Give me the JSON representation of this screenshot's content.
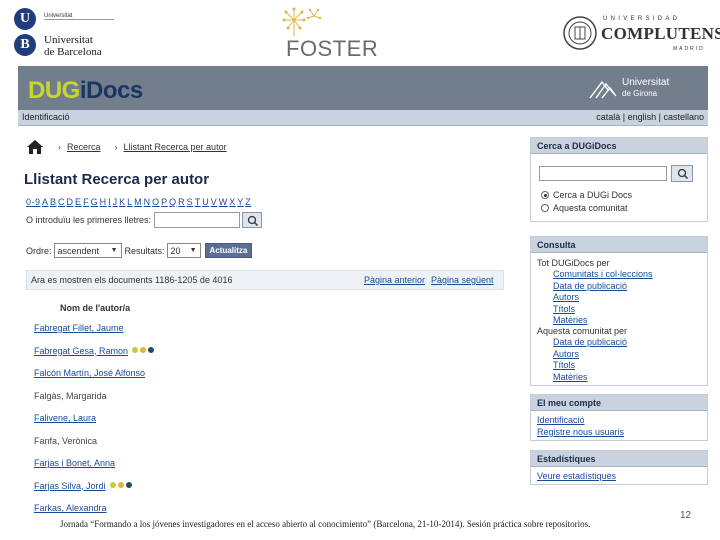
{
  "logos": {
    "ub_sub": "Universitat",
    "ub_name_1": "Universitat",
    "ub_name_2": "de Barcelona",
    "foster": "FOSTER",
    "ucm_top": "UNIVERSIDAD",
    "ucm_main": "COMPLUTENSE",
    "ucm_bottom": "MADRID"
  },
  "header": {
    "brand_a": "DUG",
    "brand_b": "i",
    "brand_c": "Docs",
    "udg_line1": "Universitat",
    "udg_line2": "de Girona",
    "ident": "Identificació",
    "langs": "català | english | castellano"
  },
  "breadcrumb": {
    "item1": "Recerca",
    "item2": "Llistant Recerca per autor"
  },
  "main": {
    "title": "Llistant Recerca per autor",
    "letters": [
      "0-9",
      "A",
      "B",
      "C",
      "D",
      "E",
      "F",
      "G",
      "H",
      "I",
      "J",
      "K",
      "L",
      "M",
      "N",
      "O",
      "P",
      "Q",
      "R",
      "S",
      "T",
      "U",
      "V",
      "W",
      "X",
      "Y",
      "Z"
    ],
    "prefix_label": "O introduïu les primeres lletres:",
    "order_label": "Ordre:",
    "order_value": "ascendent",
    "results_label": "Resultats:",
    "results_value": "20",
    "update_label": "Actualitza",
    "showing": "Ara es mostren els documents 1186-1205 de 4016",
    "prev": "Pàgina anterior",
    "next": "Pàgina següent",
    "col_header": "Nom de l'autor/a"
  },
  "authors": [
    {
      "name": "Fabregat Fillet, Jaume",
      "link": true,
      "dots": []
    },
    {
      "name": "Fabregat Gesa, Ramon",
      "link": true,
      "dots": [
        "#c3cd3a",
        "#e2b733",
        "#1f4f5c"
      ]
    },
    {
      "name": "Falcón Martín, José Alfonso",
      "link": true,
      "dots": []
    },
    {
      "name": "Falgàs, Margarida",
      "link": false,
      "dots": []
    },
    {
      "name": "Falivene, Laura",
      "link": true,
      "dots": []
    },
    {
      "name": "Fanfa, Verònica",
      "link": false,
      "dots": []
    },
    {
      "name": "Farjas i Bonet, Anna",
      "link": true,
      "dots": []
    },
    {
      "name": "Farjas Silva, Jordi",
      "link": true,
      "dots": [
        "#c3cd3a",
        "#e2b733",
        "#1f4f5c"
      ]
    },
    {
      "name": "Farkas, Alexandra",
      "link": true,
      "dots": []
    }
  ],
  "sidebar": {
    "search_title": "Cerca a DUGiDocs",
    "radio1": "Cerca a DUGi Docs",
    "radio2": "Aquesta comunitat",
    "consulta_title": "Consulta",
    "all_label": "Tot DUGiDocs per",
    "all_links": [
      "Comunitats i col·leccions",
      "Data de publicació",
      "Autors",
      "Títols",
      "Matèries"
    ],
    "this_label": "Aquesta comunitat per",
    "this_links": [
      "Data de publicació",
      "Autors",
      "Títols",
      "Matèries"
    ],
    "account_title": "El meu compte",
    "account_links": [
      "Identificació",
      "Registre nous usuaris"
    ],
    "stats_title": "Estadístiques",
    "stats_link": "Veure estadístiques"
  },
  "footer": {
    "text": "Jornada “Formando a los jóvenes investigadores en el acceso abierto al conocimiento” (Barcelona, 21-10-2014). Sesión práctica sobre repositorios.",
    "page": "12"
  },
  "colors": {
    "banner": "#737e8d",
    "brand_green": "#c8d630",
    "brand_navy": "#1b3466",
    "panel_header": "#c9d3df",
    "link": "#1a4a9a"
  }
}
